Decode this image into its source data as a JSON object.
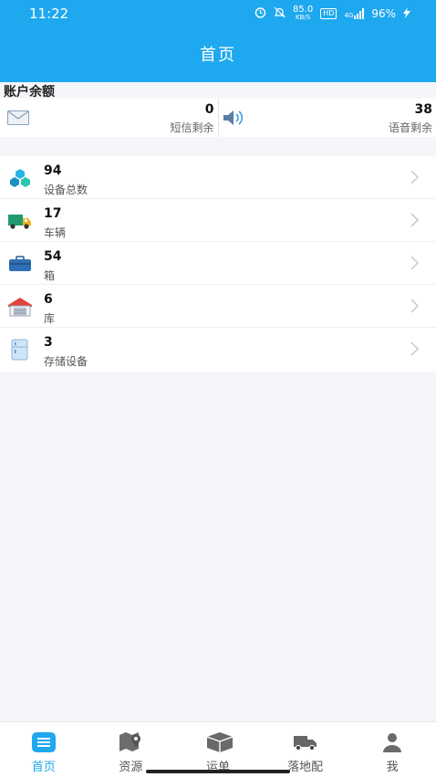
{
  "status_bar": {
    "time": "11:22",
    "net_speed_value": "85.0",
    "net_speed_unit": "KB/S",
    "hd": "HD",
    "network": "4G",
    "battery": "96%"
  },
  "header": {
    "title": "首页"
  },
  "balance": {
    "label": "账户余额",
    "sms": {
      "value": "0",
      "label": "短信剩余",
      "icon": "mail-icon"
    },
    "voice": {
      "value": "38",
      "label": "语音剩余",
      "icon": "speaker-icon"
    }
  },
  "resources": [
    {
      "value": "94",
      "label": "设备总数",
      "icon": "devices-icon"
    },
    {
      "value": "17",
      "label": "车辆",
      "icon": "truck-icon"
    },
    {
      "value": "54",
      "label": "箱",
      "icon": "box-icon"
    },
    {
      "value": "6",
      "label": "库",
      "icon": "warehouse-icon"
    },
    {
      "value": "3",
      "label": "存储设备",
      "icon": "fridge-icon"
    }
  ],
  "tabbar": {
    "items": [
      {
        "label": "首页",
        "icon": "home-list-icon",
        "active": true
      },
      {
        "label": "资源",
        "icon": "map-pin-icon",
        "active": false
      },
      {
        "label": "运单",
        "icon": "package-icon",
        "active": false
      },
      {
        "label": "落地配",
        "icon": "delivery-truck-icon",
        "active": false
      },
      {
        "label": "我",
        "icon": "user-icon",
        "active": false
      }
    ]
  },
  "colors": {
    "primary": "#1ea8ef",
    "background": "#f5f6fa",
    "tab_inactive": "#666666"
  }
}
